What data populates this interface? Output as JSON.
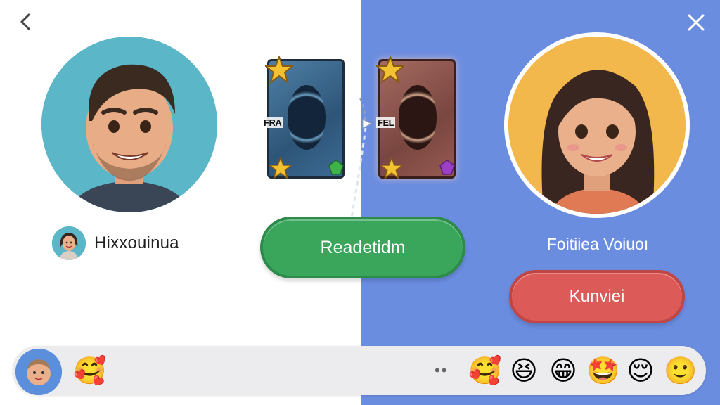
{
  "nav": {
    "back_icon": "chevron-left-icon",
    "close_icon": "close-icon"
  },
  "player": {
    "name": "Hixxouinua"
  },
  "opponent": {
    "name": "Foitiiea Voiuoı"
  },
  "cards": {
    "left": {
      "label": "FRA"
    },
    "right": {
      "label": "FEL"
    }
  },
  "actions": {
    "ready_label": "Readetidm",
    "cancel_label": "Kunviei"
  },
  "emoji_bar": {
    "left_emoji": "🥰",
    "more_dots": "••",
    "emojis": [
      "🥰",
      "😆",
      "😁",
      "🤩",
      "😌",
      "🙂"
    ]
  },
  "colors": {
    "right_panel": "#6b8de0",
    "ready": "#3aa65c",
    "cancel": "#dc5a58",
    "player_bg": "#5bb6c8",
    "opponent_bg": "#f3b84b"
  }
}
